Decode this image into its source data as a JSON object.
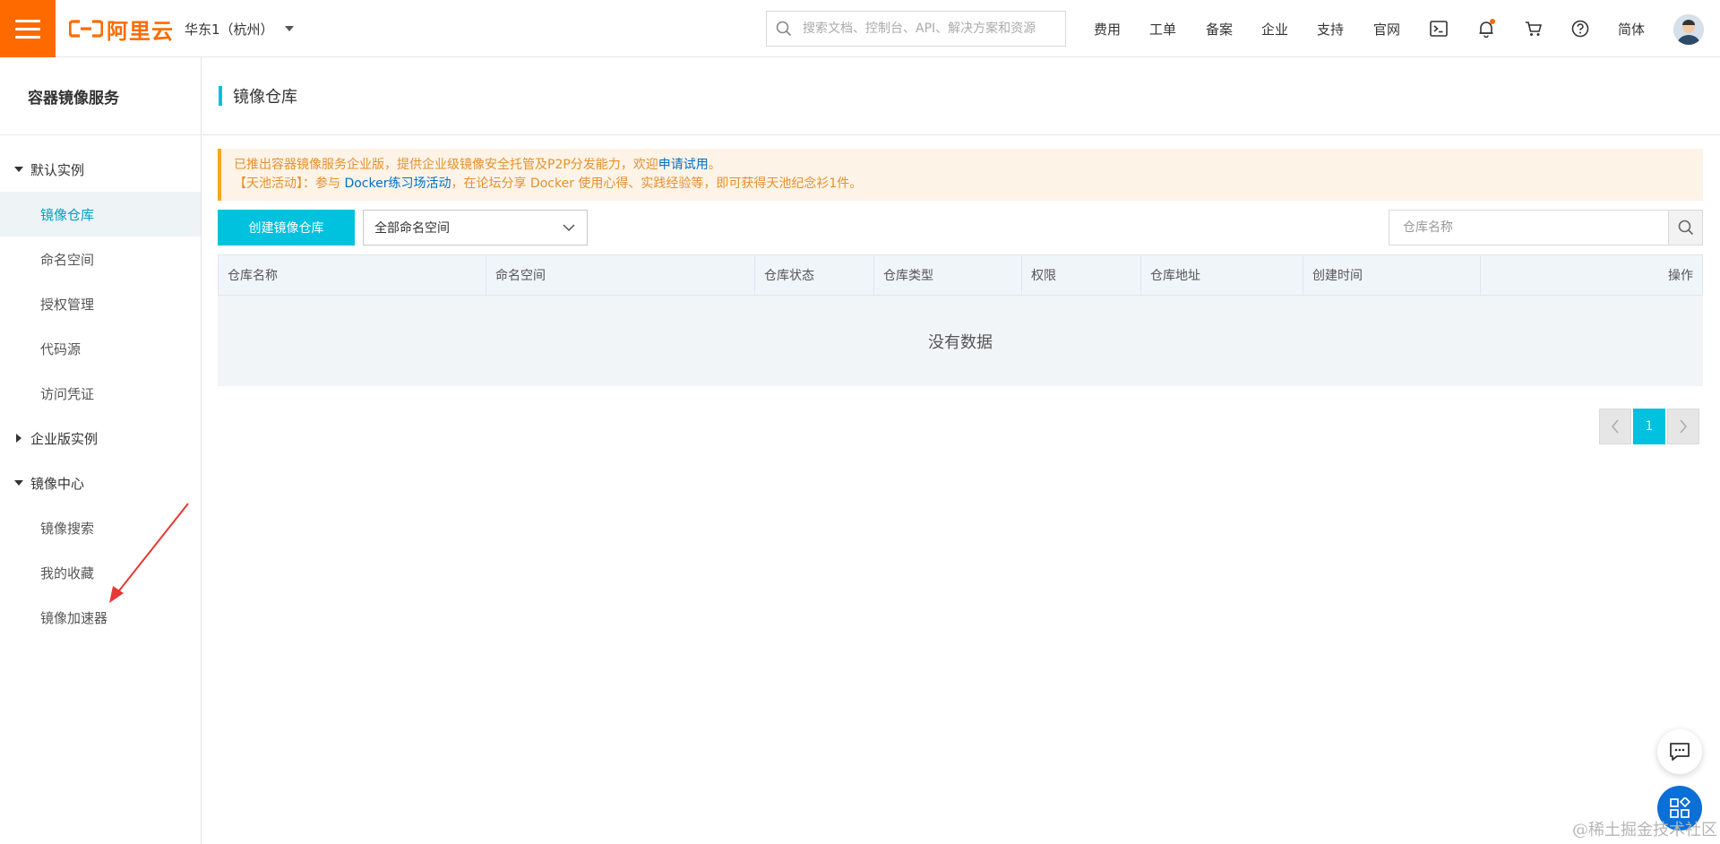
{
  "topbar": {
    "logo_text": "阿里云",
    "region": "华东1（杭州）",
    "search_placeholder": "搜索文档、控制台、API、解决方案和资源",
    "nav": [
      "费用",
      "工单",
      "备案",
      "企业",
      "支持",
      "官网"
    ],
    "language": "简体",
    "icons": [
      "terminal-icon",
      "bell-icon",
      "cart-icon",
      "help-icon"
    ],
    "accent_color": "#ff6a00"
  },
  "sidebar": {
    "title": "容器镜像服务",
    "groups": [
      {
        "label": "默认实例",
        "expanded": true,
        "items": [
          {
            "label": "镜像仓库",
            "active": true
          },
          {
            "label": "命名空间"
          },
          {
            "label": "授权管理"
          },
          {
            "label": "代码源"
          },
          {
            "label": "访问凭证"
          }
        ]
      },
      {
        "label": "企业版实例",
        "expanded": false,
        "items": []
      },
      {
        "label": "镜像中心",
        "expanded": true,
        "items": [
          {
            "label": "镜像搜索"
          },
          {
            "label": "我的收藏"
          },
          {
            "label": "镜像加速器"
          }
        ]
      }
    ]
  },
  "main": {
    "page_title": "镜像仓库",
    "notice": {
      "line1_prefix": "已推出容器镜像服务企业版，提供企业级镜像安全托管及P2P分发能力，欢迎",
      "line1_link": "申请试用",
      "line1_suffix": "。",
      "line2_prefix": "【天池活动】：参与 ",
      "line2_link": "Docker练习场活动",
      "line2_suffix": "，在论坛分享 Docker 使用心得、实践经验等，即可获得天池纪念衫1件。"
    },
    "create_button": "创建镜像仓库",
    "namespace_select": "全部命名空间",
    "repo_search_placeholder": "仓库名称",
    "table": {
      "columns": [
        "仓库名称",
        "命名空间",
        "仓库状态",
        "仓库类型",
        "权限",
        "仓库地址",
        "创建时间",
        "操作"
      ],
      "empty_text": "没有数据"
    },
    "pagination": {
      "current": "1"
    },
    "primary_color": "#00c1de"
  },
  "watermark": "@稀土掘金技术社区"
}
